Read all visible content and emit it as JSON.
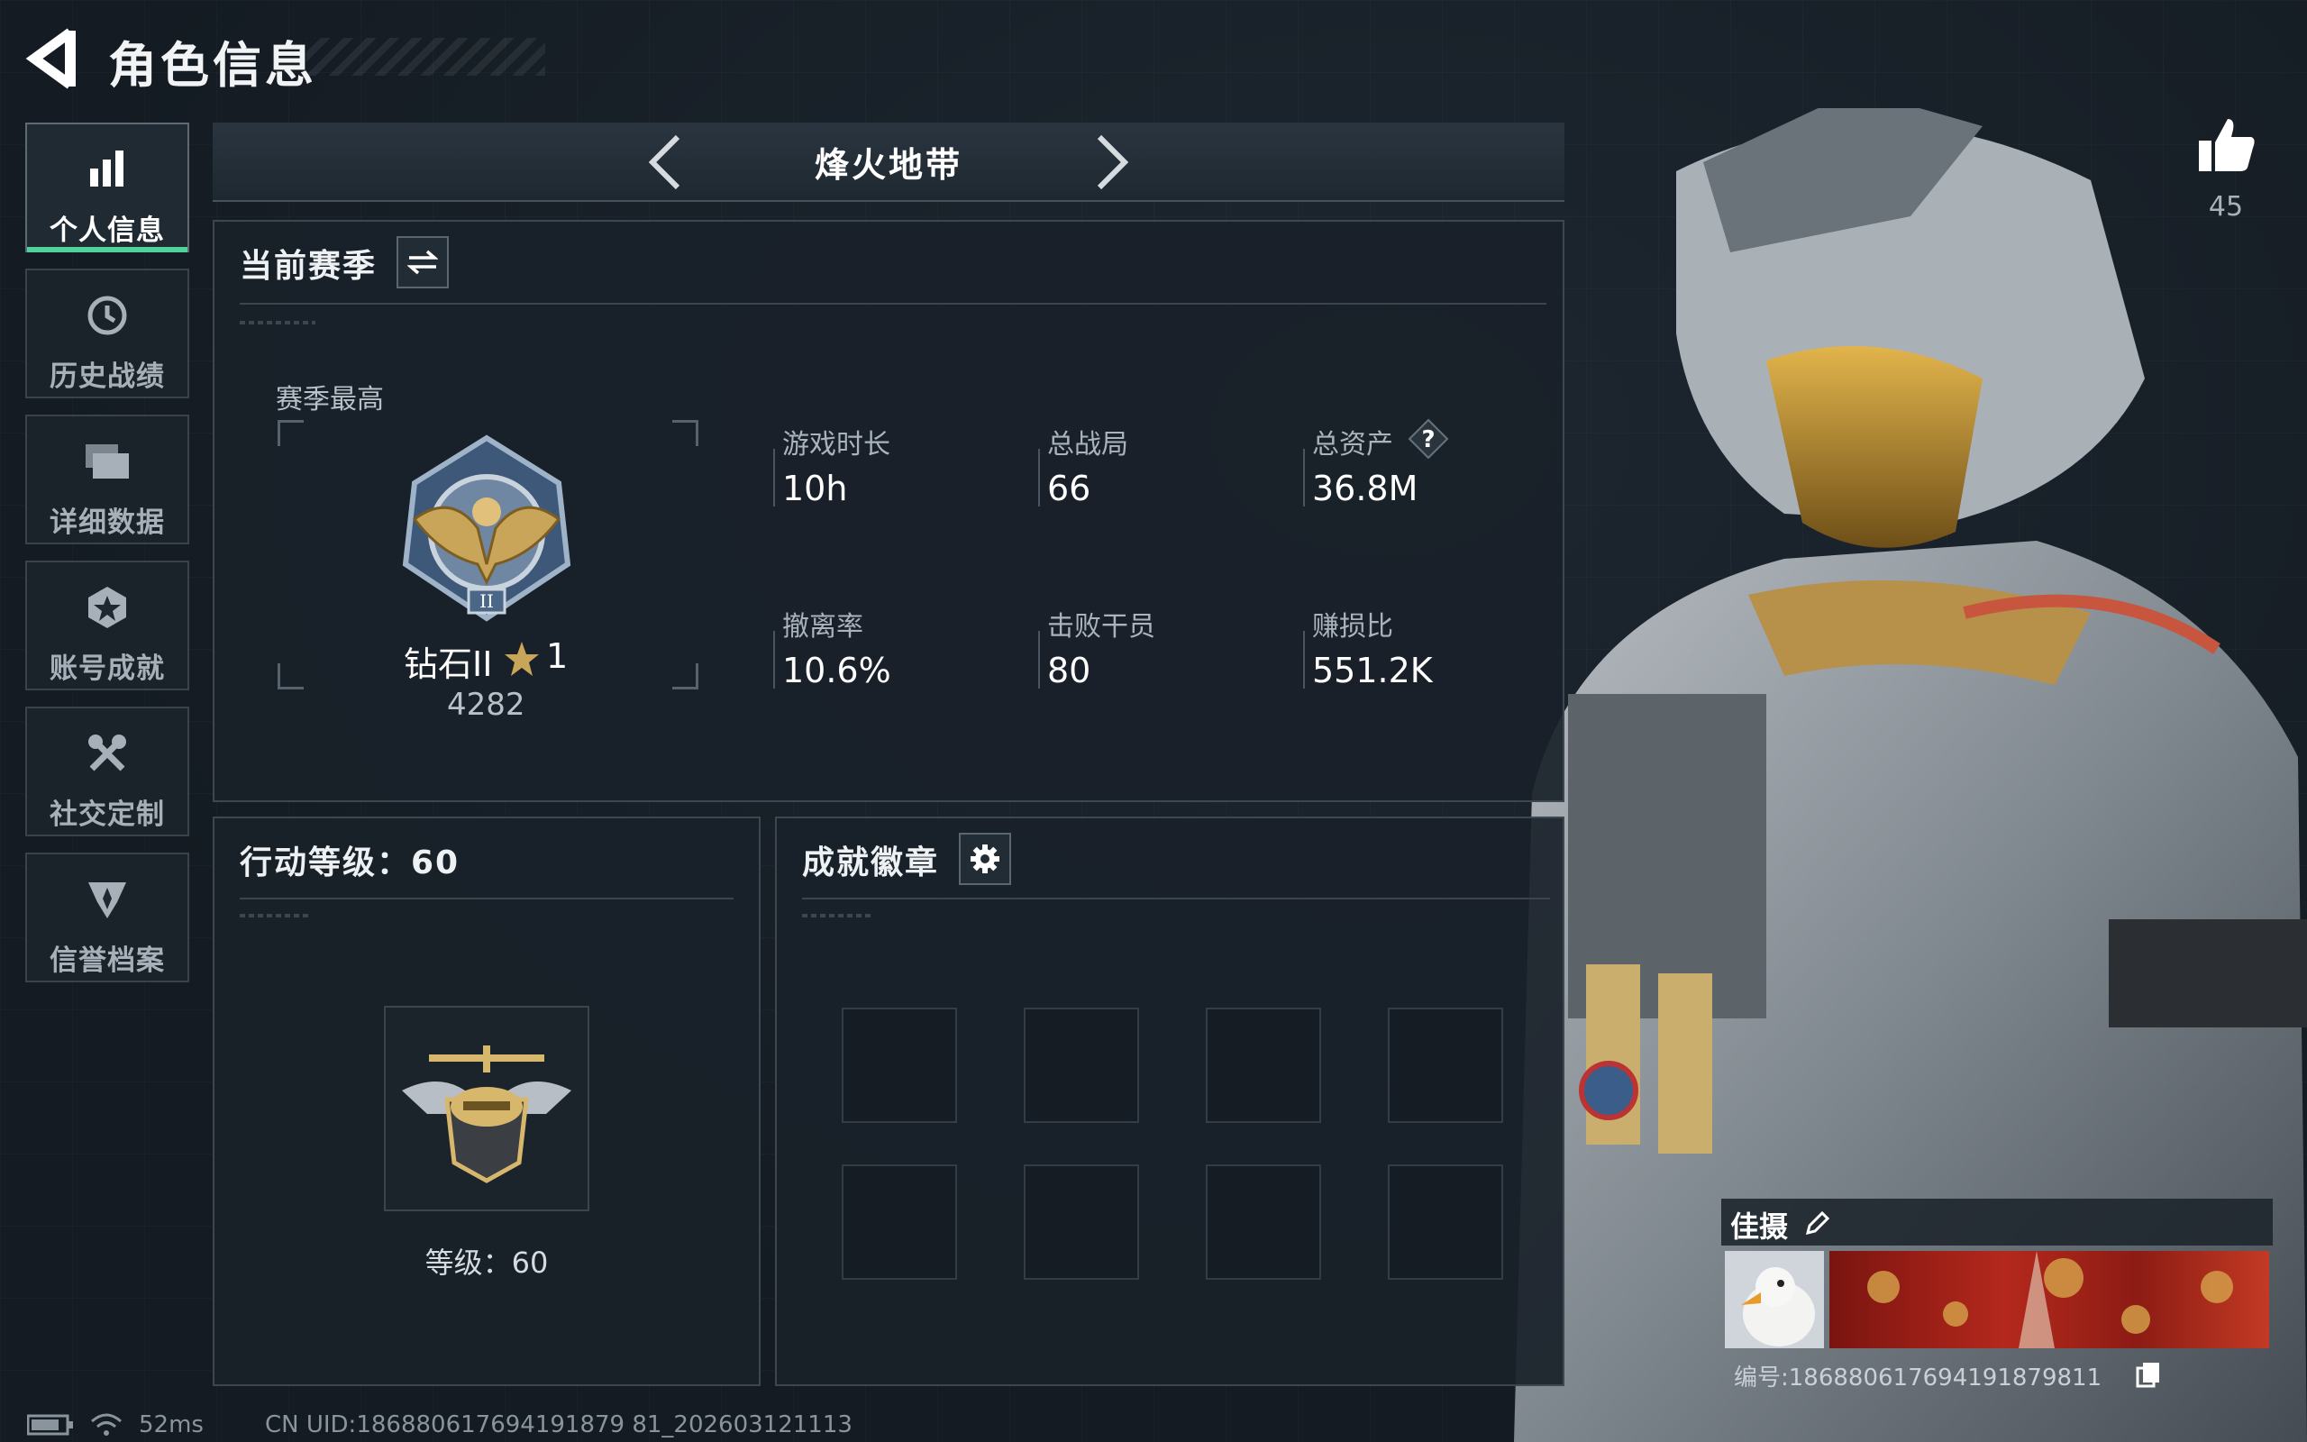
{
  "header": {
    "title": "角色信息"
  },
  "sidebar": {
    "items": [
      {
        "label": "个人信息",
        "icon": "bar-chart-icon",
        "active": true
      },
      {
        "label": "历史战绩",
        "icon": "clock-history-icon"
      },
      {
        "label": "详细数据",
        "icon": "folder-data-icon"
      },
      {
        "label": "账号成就",
        "icon": "achievement-star-icon"
      },
      {
        "label": "社交定制",
        "icon": "tools-icon"
      },
      {
        "label": "信誉档案",
        "icon": "shield-emblem-icon"
      }
    ]
  },
  "mode": {
    "label": "烽火地带"
  },
  "season": {
    "title": "当前赛季",
    "best_label": "赛季最高",
    "rank_name": "钻石II",
    "rank_stars": "1",
    "rank_points": "4282",
    "stats": [
      {
        "label": "游戏时长",
        "value": "10h"
      },
      {
        "label": "总战局",
        "value": "66"
      },
      {
        "label": "总资产",
        "value": "36.8M"
      },
      {
        "label": "撤离率",
        "value": "10.6%"
      },
      {
        "label": "击败干员",
        "value": "80"
      },
      {
        "label": "赚损比",
        "value": "551.2K"
      }
    ]
  },
  "action_level": {
    "title": "行动等级：60",
    "level_text": "等级：60"
  },
  "badges": {
    "title": "成就徽章"
  },
  "like": {
    "count": "45"
  },
  "album": {
    "title": "佳摄",
    "id_text": "编号:186880617694191879811"
  },
  "status_bar": {
    "ping": "52ms",
    "uid": "CN UID:186880617694191879 81_202603121113"
  },
  "colors": {
    "accent_green": "#4fd39a",
    "gold": "#c9a55a"
  }
}
